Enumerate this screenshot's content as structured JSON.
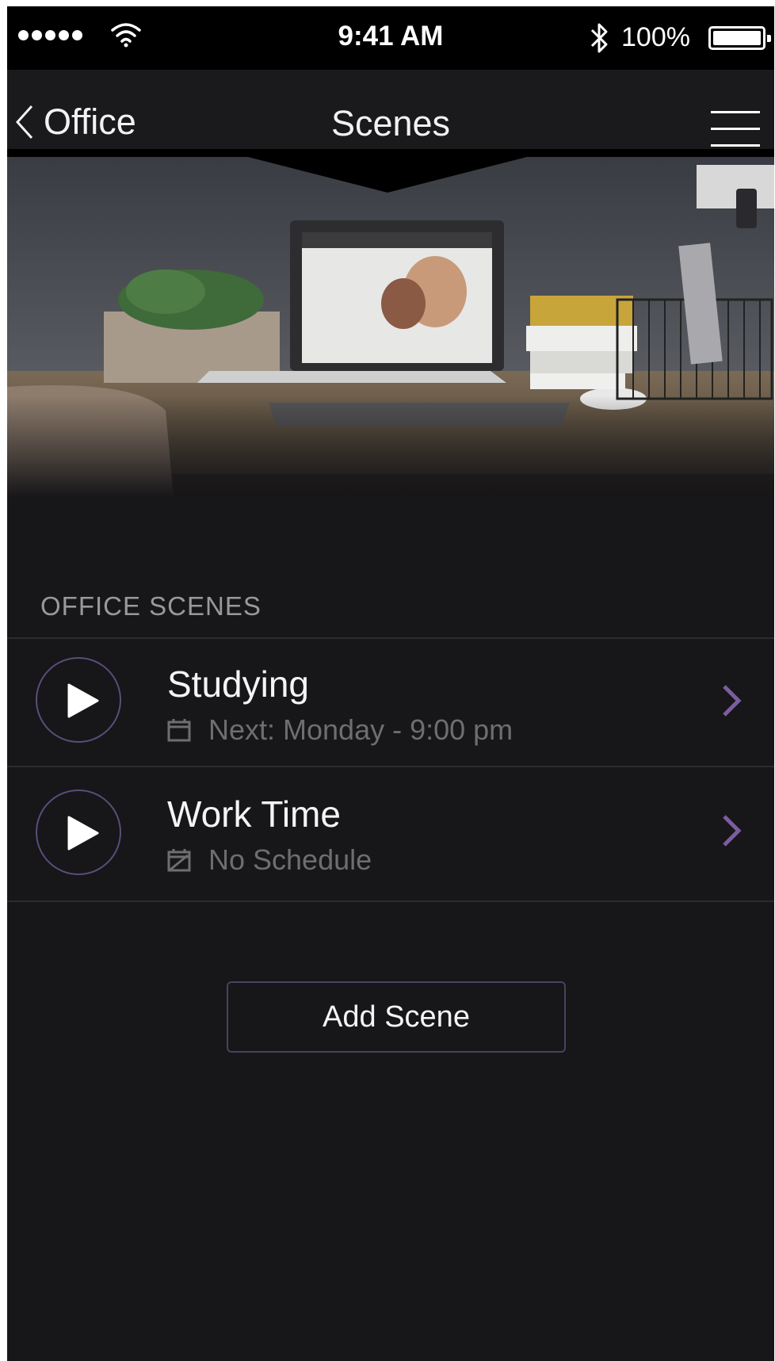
{
  "status_bar": {
    "time": "9:41 AM",
    "battery": "100%",
    "signal_icon": "signal-dots-icon",
    "wifi_icon": "wifi-icon",
    "bluetooth_icon": "bluetooth-icon",
    "battery_level": 1.0
  },
  "nav": {
    "back_label": "Office",
    "title": "Scenes",
    "menu_icon": "hamburger-menu-icon"
  },
  "section": {
    "header": "OFFICE SCENES"
  },
  "scenes": [
    {
      "name": "Studying",
      "schedule": "Next: Monday - 9:00 pm",
      "schedule_icon": "calendar-icon"
    },
    {
      "name": "Work Time",
      "schedule": "No Schedule",
      "schedule_icon": "calendar-off-icon"
    }
  ],
  "actions": {
    "add_scene": "Add Scene"
  },
  "colors": {
    "background": "#171618",
    "accent": "#7a5e9e",
    "accent_border": "#5b4c7c",
    "muted_text": "#6f6d71"
  }
}
